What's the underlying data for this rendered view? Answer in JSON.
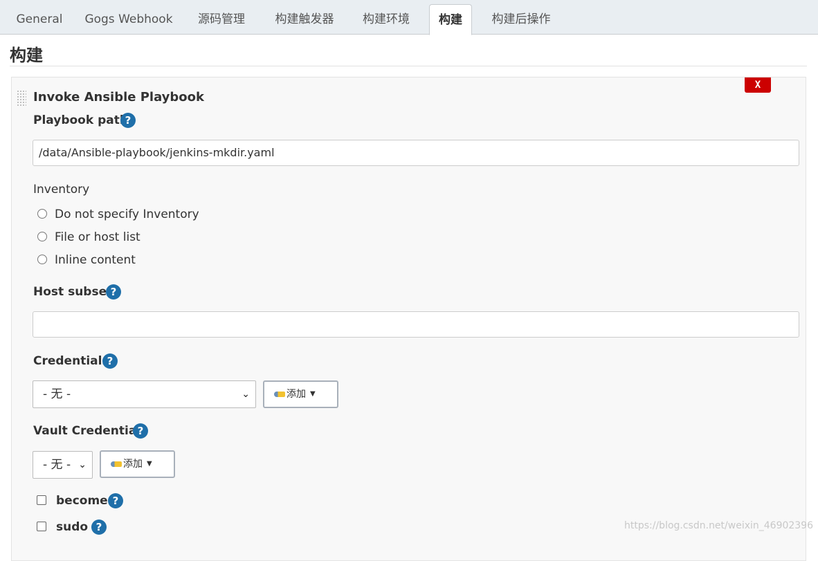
{
  "tabs": [
    {
      "label": "General",
      "active": false
    },
    {
      "label": "Gogs Webhook",
      "active": false
    },
    {
      "label": "源码管理",
      "active": false
    },
    {
      "label": "构建触发器",
      "active": false
    },
    {
      "label": "构建环境",
      "active": false
    },
    {
      "label": "构建",
      "active": true
    },
    {
      "label": "构建后操作",
      "active": false
    }
  ],
  "section": {
    "title": "构建"
  },
  "step": {
    "title": "Invoke Ansible Playbook",
    "delete_label": "X",
    "playbook_path_label": "Playbook path",
    "playbook_path_value": "/data/Ansible-playbook/jenkins-mkdir.yaml",
    "inventory_label": "Inventory",
    "inventory_options": [
      "Do not specify Inventory",
      "File or host list",
      "Inline content"
    ],
    "host_subset_label": "Host subset",
    "host_subset_value": "",
    "credentials_label": "Credentials",
    "credentials_selected": "- 无 -",
    "add_label": "添加",
    "vault_credentials_label": "Vault Credentials",
    "vault_credentials_selected": "- 无 -",
    "become_label": "become",
    "sudo_label": "sudo",
    "help_glyph": "?"
  },
  "watermark": "https://blog.csdn.net/weixin_46902396",
  "colors": {
    "tabbar_bg": "#e9eef2",
    "help_icon": "#1f6fa9",
    "delete_button": "#cc0000"
  }
}
